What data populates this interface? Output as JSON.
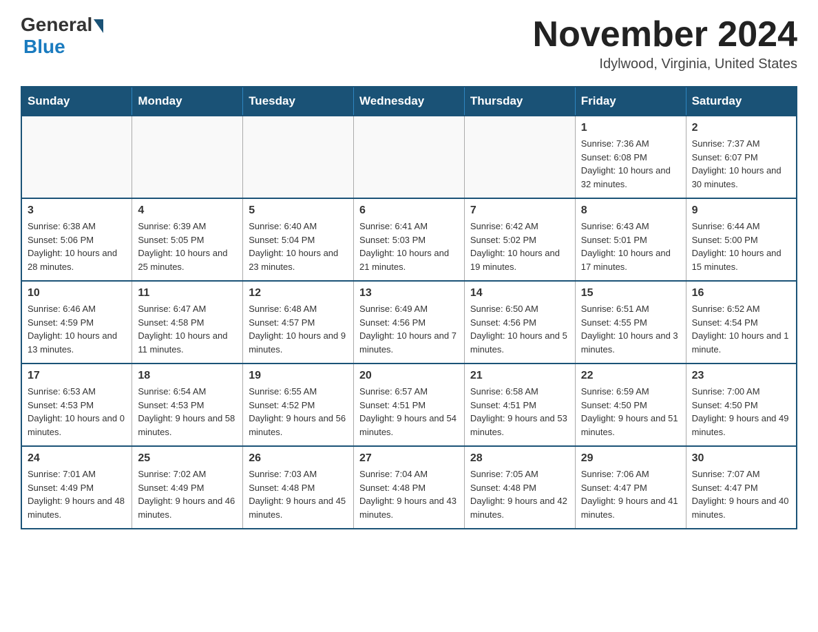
{
  "header": {
    "logo_general": "General",
    "logo_blue": "Blue",
    "month_title": "November 2024",
    "location": "Idylwood, Virginia, United States"
  },
  "calendar": {
    "days_of_week": [
      "Sunday",
      "Monday",
      "Tuesday",
      "Wednesday",
      "Thursday",
      "Friday",
      "Saturday"
    ],
    "weeks": [
      [
        {
          "day": "",
          "info": ""
        },
        {
          "day": "",
          "info": ""
        },
        {
          "day": "",
          "info": ""
        },
        {
          "day": "",
          "info": ""
        },
        {
          "day": "",
          "info": ""
        },
        {
          "day": "1",
          "info": "Sunrise: 7:36 AM\nSunset: 6:08 PM\nDaylight: 10 hours and 32 minutes."
        },
        {
          "day": "2",
          "info": "Sunrise: 7:37 AM\nSunset: 6:07 PM\nDaylight: 10 hours and 30 minutes."
        }
      ],
      [
        {
          "day": "3",
          "info": "Sunrise: 6:38 AM\nSunset: 5:06 PM\nDaylight: 10 hours and 28 minutes."
        },
        {
          "day": "4",
          "info": "Sunrise: 6:39 AM\nSunset: 5:05 PM\nDaylight: 10 hours and 25 minutes."
        },
        {
          "day": "5",
          "info": "Sunrise: 6:40 AM\nSunset: 5:04 PM\nDaylight: 10 hours and 23 minutes."
        },
        {
          "day": "6",
          "info": "Sunrise: 6:41 AM\nSunset: 5:03 PM\nDaylight: 10 hours and 21 minutes."
        },
        {
          "day": "7",
          "info": "Sunrise: 6:42 AM\nSunset: 5:02 PM\nDaylight: 10 hours and 19 minutes."
        },
        {
          "day": "8",
          "info": "Sunrise: 6:43 AM\nSunset: 5:01 PM\nDaylight: 10 hours and 17 minutes."
        },
        {
          "day": "9",
          "info": "Sunrise: 6:44 AM\nSunset: 5:00 PM\nDaylight: 10 hours and 15 minutes."
        }
      ],
      [
        {
          "day": "10",
          "info": "Sunrise: 6:46 AM\nSunset: 4:59 PM\nDaylight: 10 hours and 13 minutes."
        },
        {
          "day": "11",
          "info": "Sunrise: 6:47 AM\nSunset: 4:58 PM\nDaylight: 10 hours and 11 minutes."
        },
        {
          "day": "12",
          "info": "Sunrise: 6:48 AM\nSunset: 4:57 PM\nDaylight: 10 hours and 9 minutes."
        },
        {
          "day": "13",
          "info": "Sunrise: 6:49 AM\nSunset: 4:56 PM\nDaylight: 10 hours and 7 minutes."
        },
        {
          "day": "14",
          "info": "Sunrise: 6:50 AM\nSunset: 4:56 PM\nDaylight: 10 hours and 5 minutes."
        },
        {
          "day": "15",
          "info": "Sunrise: 6:51 AM\nSunset: 4:55 PM\nDaylight: 10 hours and 3 minutes."
        },
        {
          "day": "16",
          "info": "Sunrise: 6:52 AM\nSunset: 4:54 PM\nDaylight: 10 hours and 1 minute."
        }
      ],
      [
        {
          "day": "17",
          "info": "Sunrise: 6:53 AM\nSunset: 4:53 PM\nDaylight: 10 hours and 0 minutes."
        },
        {
          "day": "18",
          "info": "Sunrise: 6:54 AM\nSunset: 4:53 PM\nDaylight: 9 hours and 58 minutes."
        },
        {
          "day": "19",
          "info": "Sunrise: 6:55 AM\nSunset: 4:52 PM\nDaylight: 9 hours and 56 minutes."
        },
        {
          "day": "20",
          "info": "Sunrise: 6:57 AM\nSunset: 4:51 PM\nDaylight: 9 hours and 54 minutes."
        },
        {
          "day": "21",
          "info": "Sunrise: 6:58 AM\nSunset: 4:51 PM\nDaylight: 9 hours and 53 minutes."
        },
        {
          "day": "22",
          "info": "Sunrise: 6:59 AM\nSunset: 4:50 PM\nDaylight: 9 hours and 51 minutes."
        },
        {
          "day": "23",
          "info": "Sunrise: 7:00 AM\nSunset: 4:50 PM\nDaylight: 9 hours and 49 minutes."
        }
      ],
      [
        {
          "day": "24",
          "info": "Sunrise: 7:01 AM\nSunset: 4:49 PM\nDaylight: 9 hours and 48 minutes."
        },
        {
          "day": "25",
          "info": "Sunrise: 7:02 AM\nSunset: 4:49 PM\nDaylight: 9 hours and 46 minutes."
        },
        {
          "day": "26",
          "info": "Sunrise: 7:03 AM\nSunset: 4:48 PM\nDaylight: 9 hours and 45 minutes."
        },
        {
          "day": "27",
          "info": "Sunrise: 7:04 AM\nSunset: 4:48 PM\nDaylight: 9 hours and 43 minutes."
        },
        {
          "day": "28",
          "info": "Sunrise: 7:05 AM\nSunset: 4:48 PM\nDaylight: 9 hours and 42 minutes."
        },
        {
          "day": "29",
          "info": "Sunrise: 7:06 AM\nSunset: 4:47 PM\nDaylight: 9 hours and 41 minutes."
        },
        {
          "day": "30",
          "info": "Sunrise: 7:07 AM\nSunset: 4:47 PM\nDaylight: 9 hours and 40 minutes."
        }
      ]
    ]
  }
}
